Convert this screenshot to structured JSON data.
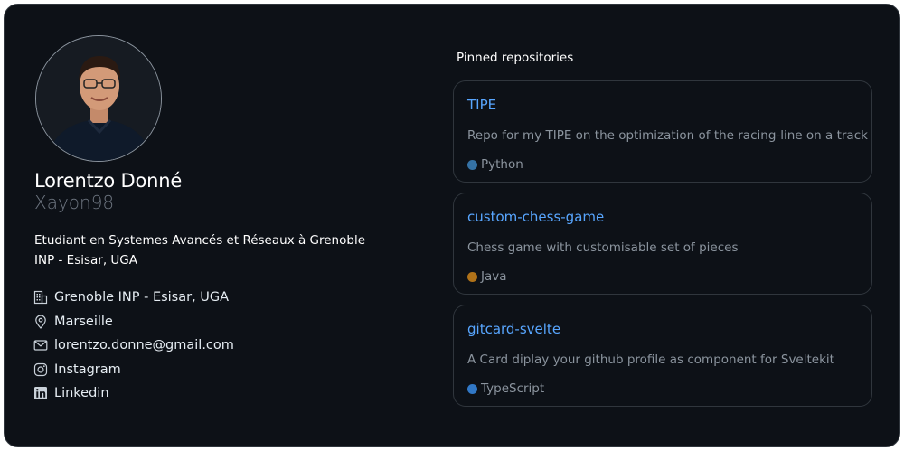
{
  "profile": {
    "name": "Lorentzo Donné",
    "username": "Xayon98",
    "bio": "Etudiant en Systemes Avancés et Réseaux à Grenoble INP - Esisar, UGA",
    "info": [
      {
        "icon": "building-icon",
        "text": "Grenoble INP - Esisar, UGA"
      },
      {
        "icon": "location-pin-icon",
        "text": "Marseille"
      },
      {
        "icon": "mail-icon",
        "text": "lorentzo.donne@gmail.com"
      },
      {
        "icon": "instagram-icon",
        "text": "Instagram"
      },
      {
        "icon": "linkedin-icon",
        "text": "Linkedin"
      }
    ]
  },
  "pinned": {
    "title": "Pinned repositories",
    "repos": [
      {
        "name": "TIPE",
        "description": "Repo for my TIPE on the optimization of the racing-line on a track",
        "language": "Python",
        "color": "#3572A5"
      },
      {
        "name": "custom-chess-game",
        "description": "Chess game with customisable set of pieces",
        "language": "Java",
        "color": "#b07219"
      },
      {
        "name": "gitcard-svelte",
        "description": "A Card diplay your github profile as component for Sveltekit",
        "language": "TypeScript",
        "color": "#3178c6"
      }
    ]
  },
  "colors": {
    "background": "#0d1117",
    "border": "#30363d",
    "link": "#58a6ff",
    "muted": "#8b949e"
  }
}
